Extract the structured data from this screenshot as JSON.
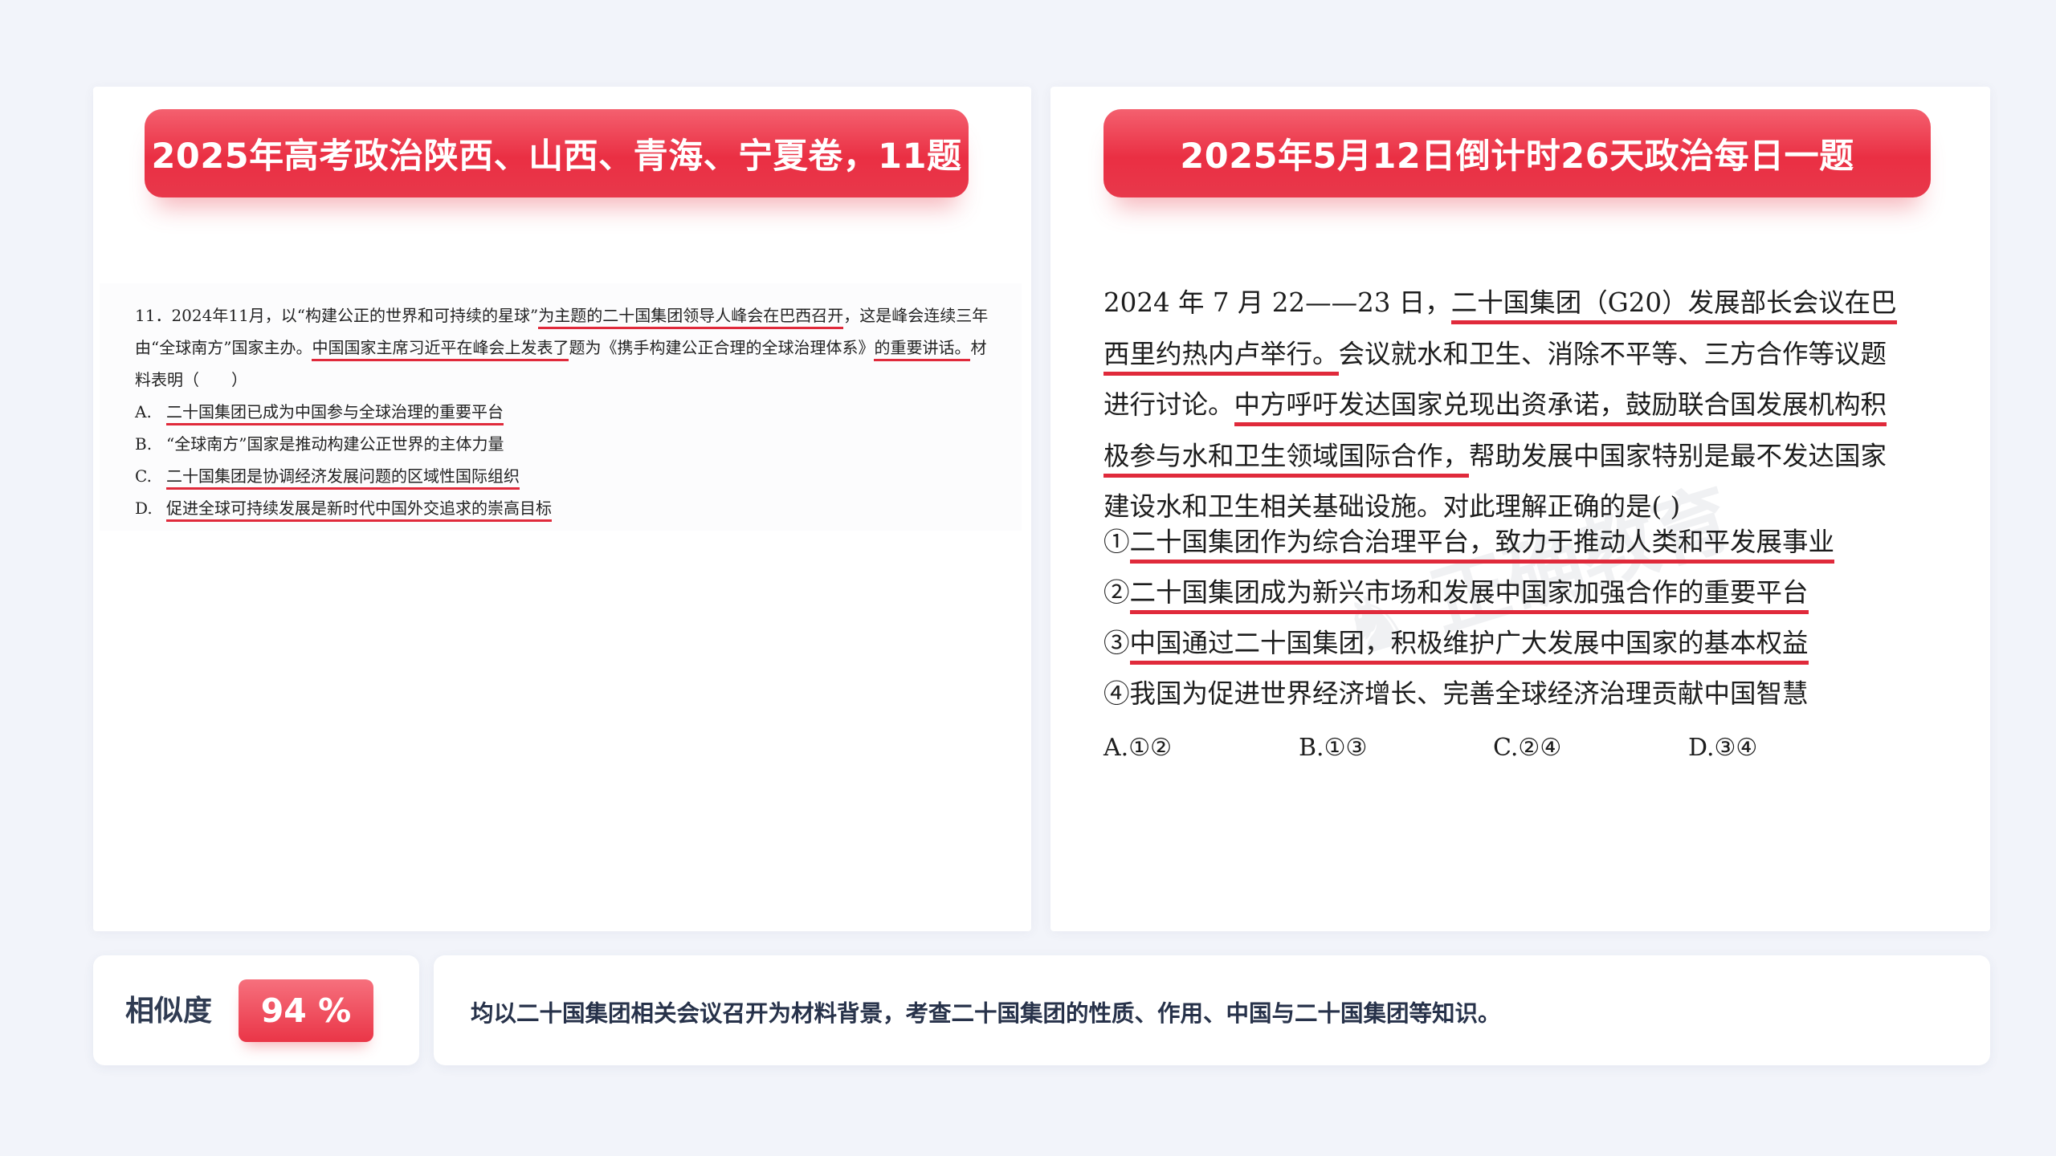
{
  "left_panel": {
    "title": "2025年高考政治陕西、山西、青海、宁夏卷，11题",
    "question": {
      "p1": "11．2024年11月，以“构建公正的世界和可持续的星球”",
      "p2": "为主题的二十国集团领导人峰会在巴西召开",
      "p3": "，这是峰会连续三年由“全球南方”国家主办。",
      "p4": "中国国家主席习近平在峰会上发表了",
      "p5": "题为《携手构建公正合理的全球治理体系》",
      "p6": "的重要讲话。",
      "p7": "材料表明（　　）"
    },
    "options": [
      {
        "label": "A.",
        "text": "二十国集团已成为中国参与全球治理的重要平台"
      },
      {
        "label": "B.",
        "text": "“全球南方”国家是推动构建公正世界的主体力量"
      },
      {
        "label": "C.",
        "text": "二十国集团是协调经济发展问题的区域性国际组织"
      },
      {
        "label": "D.",
        "text": "促进全球可持续发展是新时代中国外交追求的崇高目标"
      }
    ]
  },
  "right_panel": {
    "title": "2025年5月12日倒计时26天政治每日一题",
    "question": {
      "p1": "2024 年 7 月 22——23 日，",
      "p2": "二十国集团（G20）发展部长会议在巴西里约热内卢举行。",
      "p3": "会议就水和卫生、消除不平等、三方合作等议题进行讨论。",
      "p4": "中方呼吁发达国家兑现出资承诺，鼓励联合国发展机构积极参与水和卫生领域国际合作，",
      "p5": "帮助发展中国家特别是最不发达国家建设水和卫生相关基础设施。对此理解正确的是(   )"
    },
    "statements": [
      {
        "num": "①",
        "text": "二十国集团作为综合治理平台，致力于推动人类和平发展事业"
      },
      {
        "num": "②",
        "text": "二十国集团成为新兴市场和发展中国家加强合作的重要平台"
      },
      {
        "num": "③",
        "text": "中国通过二十国集团，积极维护广大发展中国家的基本权益"
      },
      {
        "num": "④",
        "text": "我国为促进世界经济增长、完善全球经济治理贡献中国智慧"
      }
    ],
    "choices": [
      "A.①②",
      "B.①③",
      "C.②④",
      "D.③④"
    ]
  },
  "similarity": {
    "label": "相似度",
    "value": "94 %"
  },
  "summary": "均以二十国集团相关会议召开为材料背景，考查二十国集团的性质、作用、中国与二十国集团等知识。",
  "colors": {
    "accent": "#e8384b",
    "underline": "#e02a3b",
    "background": "#f2f4fa"
  }
}
